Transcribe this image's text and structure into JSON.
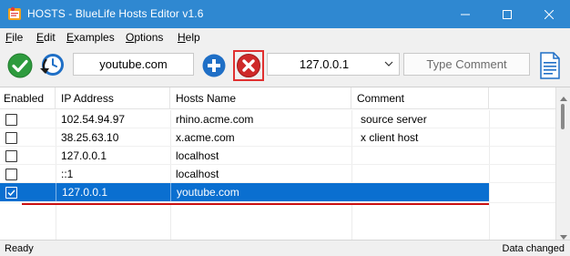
{
  "window": {
    "title": "HOSTS - BlueLife Hosts Editor v1.6"
  },
  "menu": [
    {
      "mnemonic": "F",
      "rest": "ile"
    },
    {
      "mnemonic": "E",
      "rest": "dit"
    },
    {
      "mnemonic": "E",
      "rest": "xamples"
    },
    {
      "mnemonic": "O",
      "rest": "ptions"
    },
    {
      "mnemonic": "H",
      "rest": "elp"
    }
  ],
  "toolbar": {
    "hostname_value": "youtube.com",
    "ip_value": "127.0.0.1",
    "comment_button": "Type Comment",
    "icons": [
      "check-icon",
      "clock-restore-icon",
      "add-icon",
      "delete-icon",
      "document-icon"
    ]
  },
  "table": {
    "columns": [
      "Enabled",
      "IP Address",
      "Hosts Name",
      "Comment"
    ],
    "rows": [
      {
        "enabled": false,
        "ip": "102.54.94.97",
        "host": "rhino.acme.com",
        "comment": "source server",
        "selected": false
      },
      {
        "enabled": false,
        "ip": "38.25.63.10",
        "host": "x.acme.com",
        "comment": "x client host",
        "selected": false
      },
      {
        "enabled": false,
        "ip": "127.0.0.1",
        "host": "localhost",
        "comment": "",
        "selected": false
      },
      {
        "enabled": false,
        "ip": "::1",
        "host": "localhost",
        "comment": "",
        "selected": false
      },
      {
        "enabled": true,
        "ip": "127.0.0.1",
        "host": "youtube.com",
        "comment": "",
        "selected": true
      }
    ]
  },
  "status": {
    "left": "Ready",
    "right": "Data changed"
  },
  "colors": {
    "titlebar": "#2f88d1",
    "selection": "#0a6fd0",
    "highlight_red": "#e03030"
  }
}
